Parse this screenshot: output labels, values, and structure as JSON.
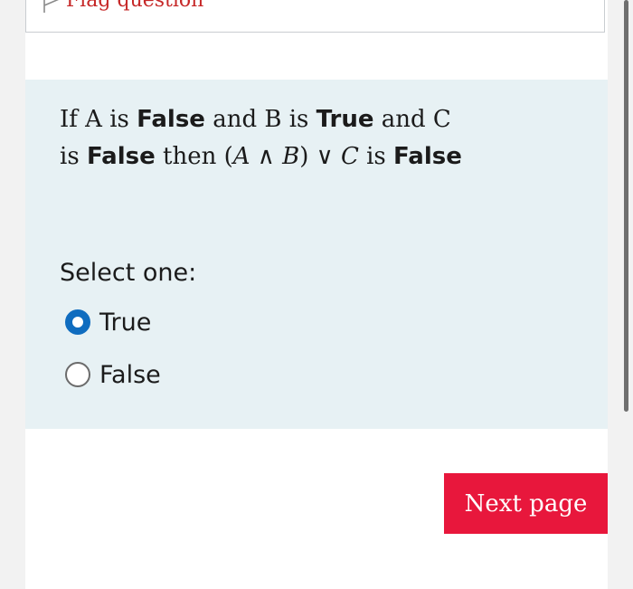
{
  "flag": {
    "label": "Flag question",
    "icon": "flag-icon"
  },
  "question": {
    "line1_part1": "If A is ",
    "line1_bold1": "False",
    "line1_part2": " and B is ",
    "line1_bold2": "True",
    "line1_part3": " and C",
    "line2_part1": "is ",
    "line2_bold1": "False",
    "line2_part2": " then ",
    "math_open": "(",
    "math_a": "A",
    "math_and": " ∧ ",
    "math_b": "B",
    "math_close": ")",
    "math_or": " ∨ ",
    "math_c": "C",
    "line2_part3": " is ",
    "line2_bold2": "False"
  },
  "answer": {
    "prompt": "Select one:",
    "options": [
      {
        "label": "True",
        "selected": true
      },
      {
        "label": "False",
        "selected": false
      }
    ]
  },
  "navigation": {
    "next_label": "Next page"
  },
  "colors": {
    "panel_background": "#e7f1f4",
    "radio_accent": "#0f6cbf",
    "button_background": "#e8173c",
    "flag_text": "#c62828"
  }
}
